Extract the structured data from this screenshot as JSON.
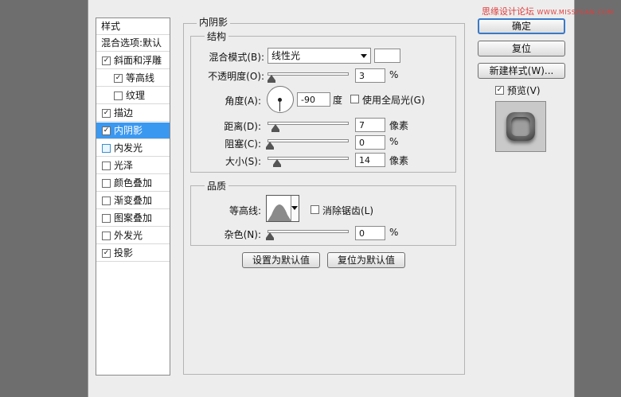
{
  "watermark": {
    "cn": "思缘设计论坛",
    "en": "WWW.MISSYUAN.COM"
  },
  "left_panel": {
    "header": "样式",
    "blend_defaults": "混合选项:默认",
    "items": [
      {
        "label": "斜面和浮雕",
        "checked": true
      },
      {
        "label": "等高线",
        "checked": true
      },
      {
        "label": "纹理",
        "checked": false
      },
      {
        "label": "描边",
        "checked": true
      },
      {
        "label": "内阴影",
        "checked": true,
        "selected": true
      },
      {
        "label": "内发光",
        "checked": false
      },
      {
        "label": "光泽",
        "checked": false
      },
      {
        "label": "颜色叠加",
        "checked": false
      },
      {
        "label": "渐变叠加",
        "checked": false
      },
      {
        "label": "图案叠加",
        "checked": false
      },
      {
        "label": "外发光",
        "checked": false
      },
      {
        "label": "投影",
        "checked": true
      }
    ]
  },
  "inner_shadow": {
    "title": "内阴影",
    "structure": {
      "title": "结构",
      "blend_mode_label": "混合模式(B):",
      "blend_mode_value": "线性光",
      "opacity_label": "不透明度(O):",
      "opacity_value": "3",
      "opacity_unit": "%",
      "angle_label": "角度(A):",
      "angle_value": "-90",
      "angle_unit": "度",
      "global_light_label": "使用全局光(G)",
      "global_light_checked": false,
      "distance_label": "距离(D):",
      "distance_value": "7",
      "distance_unit": "像素",
      "choke_label": "阻塞(C):",
      "choke_value": "0",
      "choke_unit": "%",
      "size_label": "大小(S):",
      "size_value": "14",
      "size_unit": "像素"
    },
    "quality": {
      "title": "品质",
      "contour_label": "等高线:",
      "anti_alias_label": "消除锯齿(L)",
      "anti_alias_checked": false,
      "noise_label": "杂色(N):",
      "noise_value": "0",
      "noise_unit": "%"
    },
    "set_default": "设置为默认值",
    "reset_default": "复位为默认值"
  },
  "right_panel": {
    "ok": "确定",
    "reset": "复位",
    "new_style": "新建样式(W)...",
    "preview_label": "预览(V)",
    "preview_checked": true
  }
}
